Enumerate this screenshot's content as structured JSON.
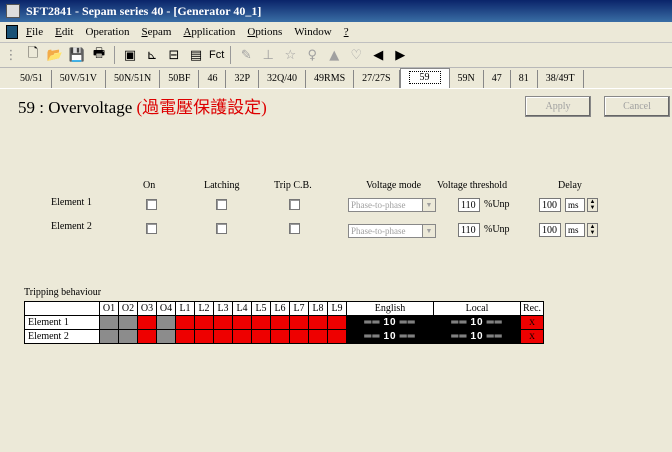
{
  "window": {
    "title": "SFT2841 - Sepam series 40 - [Generator 40_1]"
  },
  "menu": [
    {
      "label": "File",
      "u": "F",
      "rest": "ile"
    },
    {
      "label": "Edit",
      "u": "E",
      "rest": "dit"
    },
    {
      "label": "Operation",
      "u": "",
      "rest": "Operation"
    },
    {
      "label": "Sepam",
      "u": "S",
      "rest": "epam"
    },
    {
      "label": "Application",
      "u": "A",
      "rest": "pplication"
    },
    {
      "label": "Options",
      "u": "O",
      "rest": "ptions"
    },
    {
      "label": "Window",
      "u": "",
      "rest": "Window"
    },
    {
      "label": "?",
      "u": "?",
      "rest": ""
    }
  ],
  "toolbar": {
    "fct_label": "Fct"
  },
  "tabs": [
    "50/51",
    "50V/51V",
    "50N/51N",
    "50BF",
    "46",
    "32P",
    "32Q/40",
    "49RMS",
    "27/27S",
    "59",
    "59N",
    "47",
    "81",
    "38/49T"
  ],
  "active_tab": "59",
  "page": {
    "title": "59 : Overvoltage",
    "title_zh": "(過電壓保護設定)"
  },
  "buttons": {
    "apply": "Apply",
    "cancel": "Cancel"
  },
  "settings": {
    "headers": {
      "on": "On",
      "latching": "Latching",
      "trip": "Trip C.B.",
      "mode": "Voltage mode",
      "threshold": "Voltage threshold",
      "delay": "Delay"
    },
    "elements": [
      {
        "label": "Element 1",
        "mode": "Phase-to-phase",
        "threshold": "110",
        "threshold_unit": "%Unp",
        "delay": "100",
        "delay_unit": "ms"
      },
      {
        "label": "Element 2",
        "mode": "Phase-to-phase",
        "threshold": "110",
        "threshold_unit": "%Unp",
        "delay": "100",
        "delay_unit": "ms"
      }
    ]
  },
  "tripping": {
    "title": "Tripping behaviour",
    "columns": [
      "O1",
      "O2",
      "O3",
      "O4",
      "L1",
      "L2",
      "L3",
      "L4",
      "L5",
      "L6",
      "L7",
      "L8",
      "L9"
    ],
    "english_header": "English",
    "local_header": "Local",
    "rec_header": "Rec.",
    "rows": [
      {
        "label": "Element 1",
        "cells": [
          "g",
          "g",
          "r",
          "g",
          "r",
          "r",
          "r",
          "r",
          "r",
          "r",
          "r",
          "r",
          "r"
        ],
        "english": "10",
        "local": "10",
        "rec": "X"
      },
      {
        "label": "Element 2",
        "cells": [
          "g",
          "g",
          "r",
          "g",
          "r",
          "r",
          "r",
          "r",
          "r",
          "r",
          "r",
          "r",
          "r"
        ],
        "english": "10",
        "local": "10",
        "rec": "X"
      }
    ]
  },
  "colors": {
    "grey_cell": "#8c8c8c",
    "red_cell": "#ee0000",
    "title_zh": "#dd0000"
  }
}
